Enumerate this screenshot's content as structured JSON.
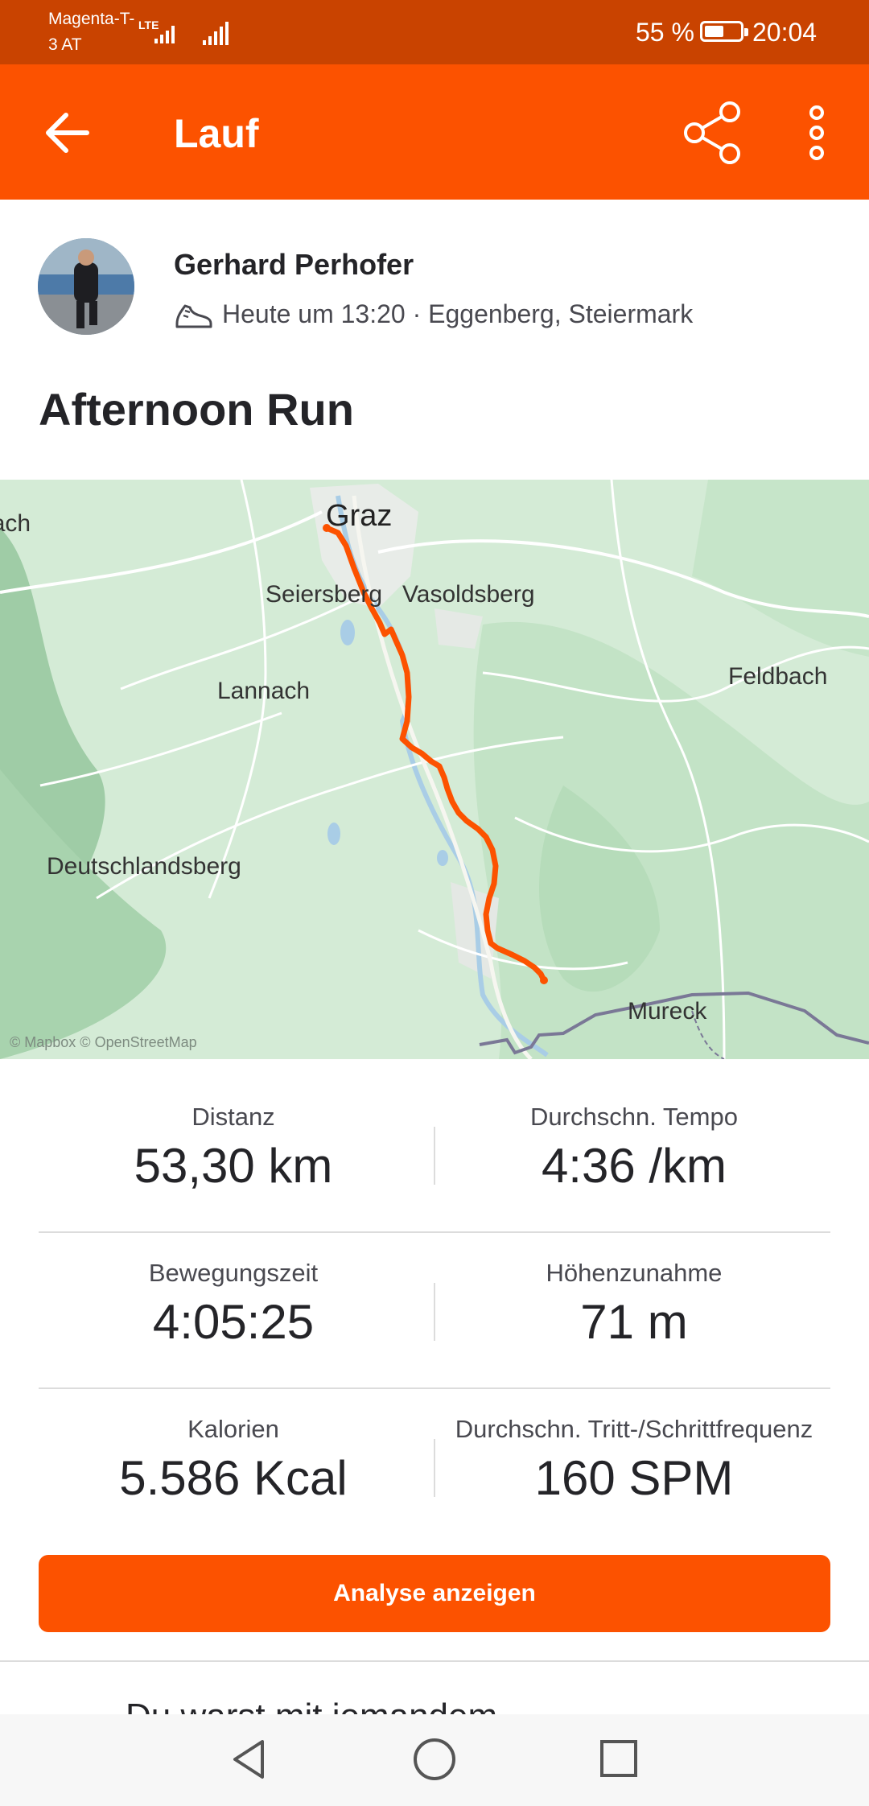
{
  "status_bar": {
    "carrier_line1": "Magenta-T-",
    "carrier_line2": "3 AT",
    "network": "LTE",
    "battery_percent": "55 %",
    "battery_level": 0.55,
    "time": "20:04"
  },
  "app_bar": {
    "title": "Lauf",
    "back_icon": "arrow-left-icon",
    "share_icon": "share-icon",
    "more_icon": "more-vertical-icon"
  },
  "activity": {
    "athlete_name": "Gerhard Perhofer",
    "meta": "Heute um 13:20 · Eggenberg, Steiermark",
    "title": "Afternoon Run"
  },
  "map": {
    "labels": [
      "Graz",
      "Köflach",
      "Seiersberg",
      "Vasoldsberg",
      "Lannach",
      "Feldbach",
      "Deutschlandsberg",
      "Mureck"
    ],
    "attribution": "© Mapbox © OpenStreetMap",
    "route_color": "#fc5200"
  },
  "stats": [
    {
      "label": "Distanz",
      "value": "53,30 km"
    },
    {
      "label": "Durchschn. Tempo",
      "value": "4:36 /km"
    },
    {
      "label": "Bewegungszeit",
      "value": "4:05:25"
    },
    {
      "label": "Höhenzunahme",
      "value": "71 m"
    },
    {
      "label": "Kalorien",
      "value": "5.586 Kcal"
    },
    {
      "label": "Durchschn. Tritt-/Schrittfrequenz",
      "value": "160 SPM"
    }
  ],
  "analysis_button": "Analyse anzeigen",
  "partial_section_text": "Du warst mit jemandem",
  "colors": {
    "brand": "#fc5200",
    "status_bar": "#c94300"
  }
}
